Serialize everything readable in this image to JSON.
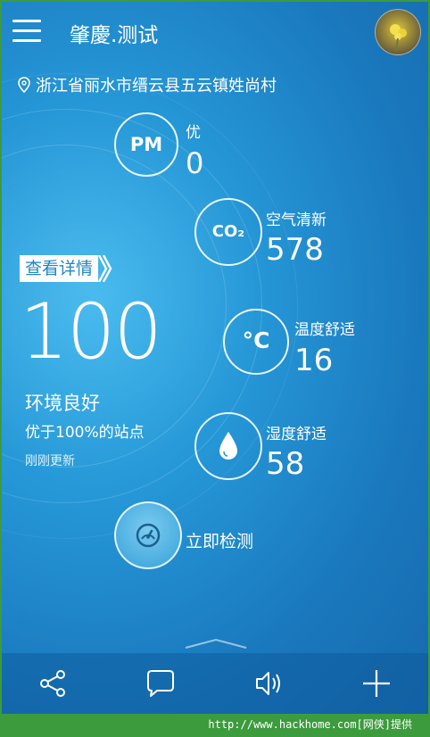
{
  "header": {
    "title": "肇慶.测试",
    "menu_icon": "hamburger-menu-icon",
    "avatar_icon": "avatar"
  },
  "location": {
    "icon": "location-pin-icon",
    "text": "浙江省丽水市缙云县五云镇姓尚村"
  },
  "metrics": [
    {
      "id": "pm",
      "icon_text": "PM",
      "label": "优",
      "value": "0"
    },
    {
      "id": "co2",
      "icon_text": "CO₂",
      "label": "空气清新",
      "value": "578"
    },
    {
      "id": "temperature",
      "icon_text": "°C",
      "label": "温度舒适",
      "value": "16"
    },
    {
      "id": "humidity",
      "icon": "water-drop-icon",
      "label": "湿度舒适",
      "value": "58"
    }
  ],
  "summary": {
    "details_button": "查看详情",
    "score": "100",
    "status": "环境良好",
    "rank": "优于100%的站点",
    "updated": "刚刚更新"
  },
  "detect": {
    "icon": "speedometer-icon",
    "label": "立即检测"
  },
  "bottom_nav": [
    {
      "id": "share",
      "icon": "share-icon"
    },
    {
      "id": "comment",
      "icon": "chat-bubble-icon"
    },
    {
      "id": "sound",
      "icon": "speaker-icon"
    },
    {
      "id": "add",
      "icon": "plus-icon"
    }
  ],
  "watermark": "http://www.hackhome.com[网侠]提供",
  "colors": {
    "background": "#2596d6",
    "frame": "#3c9b3d",
    "accent_text": "#1f86c9"
  }
}
